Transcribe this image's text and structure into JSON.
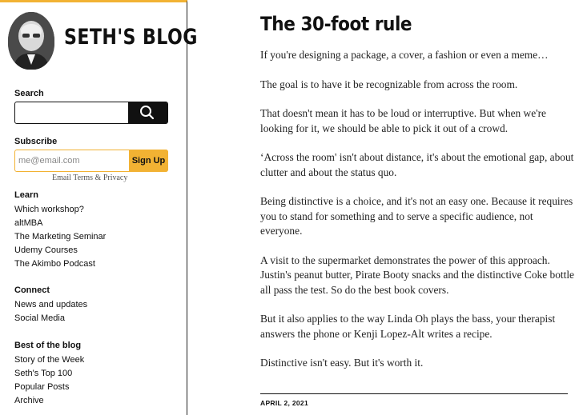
{
  "blog": {
    "title": "SETH'S BLOG"
  },
  "sidebar": {
    "search_label": "Search",
    "subscribe_label": "Subscribe",
    "email_placeholder": "me@email.com",
    "signup_label": "Sign Up",
    "terms": "Email Terms & Privacy",
    "sections": [
      {
        "heading": "Learn",
        "items": [
          "Which workshop?",
          "altMBA",
          "The Marketing Seminar",
          "Udemy Courses",
          "The Akimbo Podcast"
        ]
      },
      {
        "heading": "Connect",
        "items": [
          "News and updates",
          "Social Media"
        ]
      },
      {
        "heading": "Best of the blog",
        "items": [
          "Story of the Week",
          "Seth's Top 100",
          "Popular Posts",
          "Archive"
        ]
      }
    ]
  },
  "post": {
    "title": "The 30-foot rule",
    "paragraphs": [
      "If you're designing a package, a cover, a fashion or even a meme…",
      "The goal is to have it be recognizable from across the room.",
      "That doesn't mean it has to be loud or interruptive. But when we're looking for it, we should be able to pick it out of a crowd.",
      "‘Across the room' isn't about distance, it's about the emotional gap, about clutter and about the status quo.",
      "Being distinctive is a choice, and it's not an easy one. Because it requires you to stand for something and to serve a specific audience, not everyone.",
      "A visit to the supermarket demonstrates the power of this approach. Justin's peanut butter, Pirate Booty snacks and the distinctive Coke bottle all pass the test. So do the best book covers.",
      "But it also applies to the way Linda Oh plays the bass, your therapist answers the phone or Kenji Lopez-Alt writes a recipe.",
      "Distinctive isn't easy. But it's worth it."
    ],
    "date": "APRIL 2, 2021"
  },
  "colors": {
    "accent": "#f2b233",
    "text": "#111111"
  },
  "icons": {
    "search": "search-icon",
    "avatar": "author-avatar"
  }
}
